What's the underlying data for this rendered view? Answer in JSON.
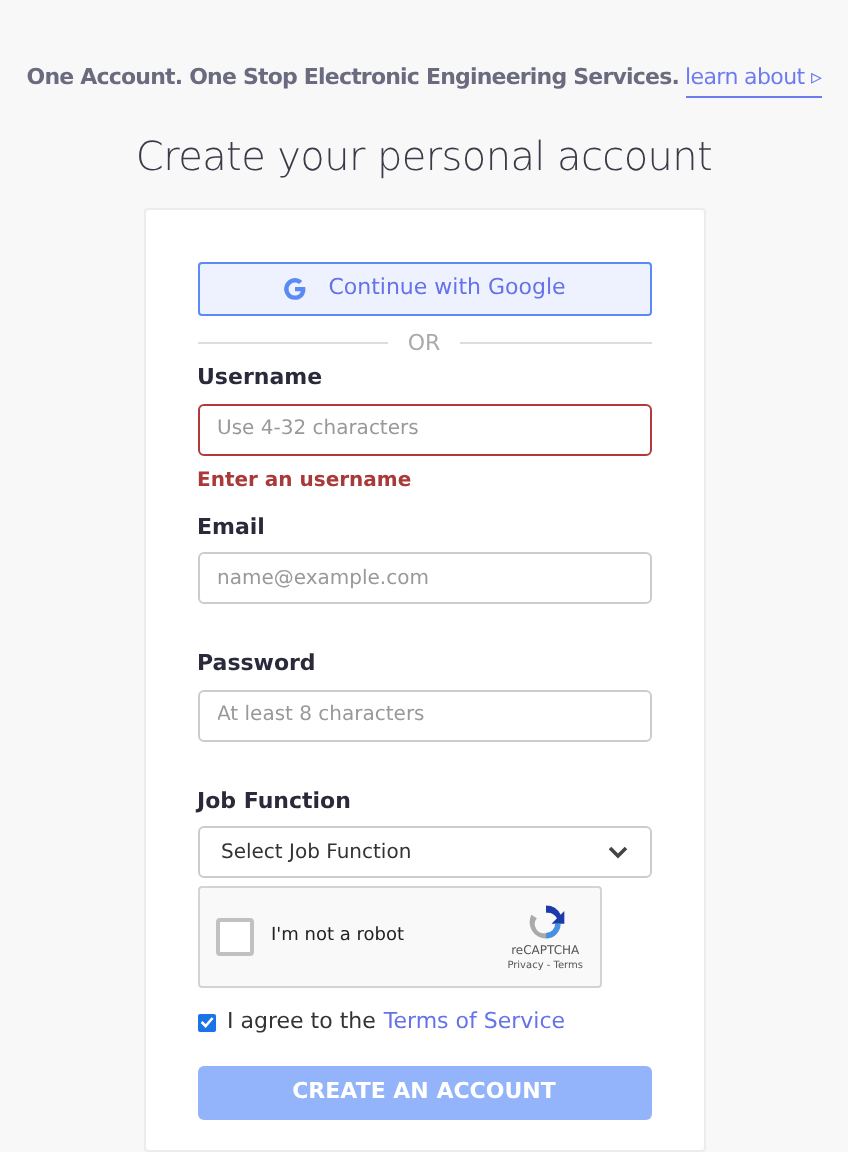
{
  "tagline": {
    "text": "One Account. One Stop Electronic Engineering Services.",
    "link": "learn about ▹"
  },
  "heading": "Create your personal account",
  "google_button": "Continue with Google",
  "divider": "OR",
  "fields": [
    {
      "kind": "text",
      "label": "Username",
      "placeholder": "Use 4-32 characters",
      "invalid": true,
      "error": "Enter an username"
    },
    {
      "kind": "text",
      "label": "Email",
      "placeholder": "name@example.com",
      "invalid": false
    },
    {
      "kind": "text",
      "label": "Password",
      "placeholder": "At least 8 characters",
      "invalid": false
    },
    {
      "kind": "select",
      "label": "Job Function",
      "value": "Select Job Function",
      "invalid": false
    }
  ],
  "captcha": {
    "label": "I'm not a robot",
    "checked": false,
    "brand": "reCAPTCHA",
    "links": "Privacy - Terms"
  },
  "agree": {
    "text": "I agree to the",
    "link": "Terms of Service",
    "checked": true
  },
  "submit": {
    "label": "CREATE AN ACCOUNT",
    "disabled": true
  }
}
